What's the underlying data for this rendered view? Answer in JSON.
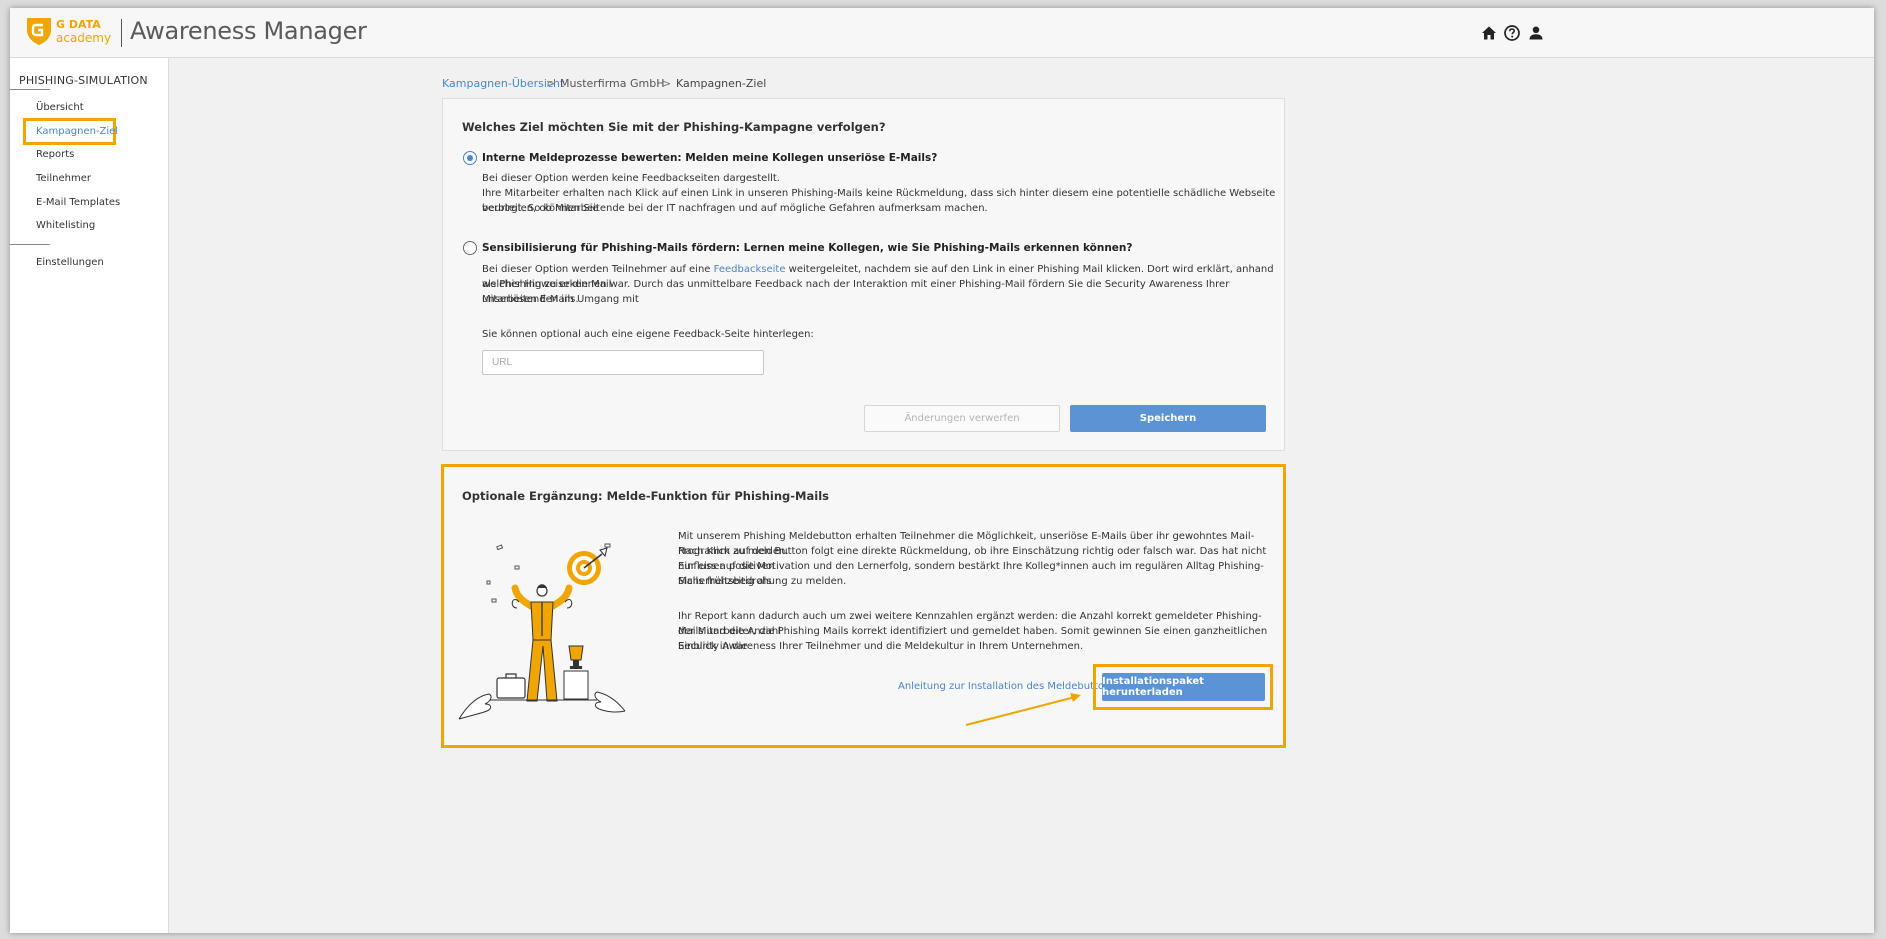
{
  "header": {
    "logo_line1": "G DATA",
    "logo_line2": "academy",
    "app_title": "Awareness Manager",
    "icons": [
      "home-icon",
      "help-icon",
      "user-icon"
    ]
  },
  "sidebar": {
    "section_title": "PHISHING-SIMULATION",
    "items": [
      {
        "label": "Übersicht"
      },
      {
        "label": "Kampagnen-Ziel"
      },
      {
        "label": "Reports"
      },
      {
        "label": "Teilnehmer"
      },
      {
        "label": "E-Mail Templates"
      },
      {
        "label": "Whitelisting"
      }
    ],
    "settings_label": "Einstellungen"
  },
  "breadcrumb": {
    "item1": "Kampagnen-Übersicht",
    "item2": "Musterfirma GmbH",
    "item3": "Kampagnen-Ziel",
    "separator": ">"
  },
  "goal_card": {
    "question": "Welches Ziel möchten Sie mit der Phishing-Kampagne verfolgen?",
    "option1": {
      "label": "Interne Meldeprozesse bewerten: Melden meine Kollegen unseriöse E-Mails?",
      "line1": "Bei dieser Option werden keine Feedbackseiten dargestellt.",
      "line2": "Ihre Mitarbeiter erhalten nach Klick auf einen Link in unseren Phishing-Mails keine Rückmeldung, dass sich hinter diesem eine potentielle schädliche Webseite verbirgt. So können Sie",
      "line3": "beurteilen, ob Mitarbeitende bei der IT nachfragen und auf mögliche Gefahren aufmerksam machen.",
      "selected": true
    },
    "option2": {
      "label": "Sensibilisierung für Phishing-Mails fördern: Lernen meine Kollegen, wie Sie Phishing-Mails erkennen können?",
      "line1_pre": "Bei dieser Option werden Teilnehmer auf eine ",
      "line1_link": "Feedbackseite",
      "line1_post": " weitergeleitet, nachdem sie auf den Link in einer Phishing Mail klicken. Dort wird erklärt, anhand welcher Hinweise die Mail",
      "line2": "als Phishing zu erkennen war. Durch das unmittelbare Feedback nach der Interaktion mit einer Phishing-Mail fördern Sie die Security Awareness Ihrer Mitarbeitenden im Umgang mit",
      "line3": "unseriösen E-Mails.",
      "selected": false
    },
    "optional_label": "Sie können optional auch eine eigene Feedback-Seite hinterlegen:",
    "url_placeholder": "URL",
    "url_value": "",
    "discard_label": "Änderungen verwerfen",
    "save_label": "Speichern"
  },
  "report_card": {
    "title": "Optionale Ergänzung: Melde-Funktion für Phishing-Mails",
    "para1_line1": "Mit unserem Phishing Meldebutton erhalten Teilnehmer die Möglichkeit, unseriöse E-Mails über ihr gewohntes Mail-Programm zu melden.",
    "para1_line2": "Nach Klick auf den Button folgt eine direkte Rückmeldung, ob ihre Einschätzung richtig oder falsch war. Das hat nicht nur einen positiven",
    "para1_line3": "Einfluss auf die Motivation und den Lernerfolg, sondern bestärkt Ihre Kolleg*innen auch im regulären Alltag Phishing-Mails frühzeitig als",
    "para1_line4": "Sicherheitsbedrohung zu melden.",
    "para2_line1": "Ihr Report kann dadurch auch um zwei weitere Kennzahlen ergänzt werden: die Anzahl korrekt gemeldeter Phishing-Mails und die Anzahl",
    "para2_line2": "der Mitarbeiter, die Phishing Mails korrekt identifiziert und gemeldet haben. Somit gewinnen Sie einen ganzheitlichen Einblick in die",
    "para2_line3": "Security Awareness Ihrer Teilnehmer und die Meldekultur in Ihrem Unternehmen.",
    "guide_link": "Anleitung zur Installation des Meldebuttons",
    "download_label": "Installationspaket herunterladen"
  },
  "colors": {
    "accent": "#f0a500",
    "primary": "#5b93d4",
    "link": "#4a86c8"
  }
}
